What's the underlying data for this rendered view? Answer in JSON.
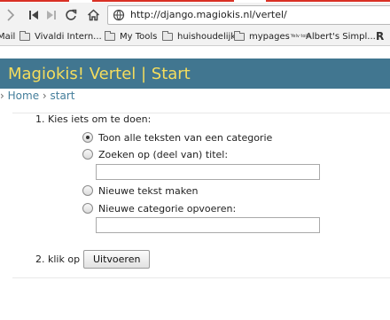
{
  "browser": {
    "url": "http://django.magiokis.nl/vertel/",
    "bookmarks": [
      {
        "label": "Mail",
        "icon": "none"
      },
      {
        "label": "Vivaldi Intern...",
        "icon": "folder-icon"
      },
      {
        "label": "My Tools",
        "icon": "folder-icon"
      },
      {
        "label": "huishoudelijk",
        "icon": "folder-icon"
      },
      {
        "label": "mypages",
        "icon": "folder-icon"
      },
      {
        "label": "Albert's Simpl...",
        "icon": "site-logo-icon",
        "logo_text": "Yelv toiis"
      },
      {
        "label": "",
        "icon": "r-logo-icon",
        "logo_text": "R"
      }
    ],
    "accent_color": "#d93025"
  },
  "page": {
    "header_title": "Magiokis! Vertel | Start",
    "header_bg": "#417690",
    "header_fg": "#f5dd5d",
    "breadcrumb": {
      "separator": "›",
      "home": "Home",
      "current": "start"
    },
    "step1": {
      "label": "1. Kies iets om te doen:",
      "options": [
        {
          "label": "Toon alle teksten van een categorie",
          "checked": true
        },
        {
          "label": "Zoeken op (deel van) titel:",
          "checked": false,
          "input_value": ""
        },
        {
          "label": "Nieuwe tekst maken",
          "checked": false
        },
        {
          "label": "Nieuwe categorie opvoeren:",
          "checked": false,
          "input_value": ""
        }
      ]
    },
    "step2": {
      "label": "2. klik op",
      "button_label": "Uitvoeren"
    }
  }
}
